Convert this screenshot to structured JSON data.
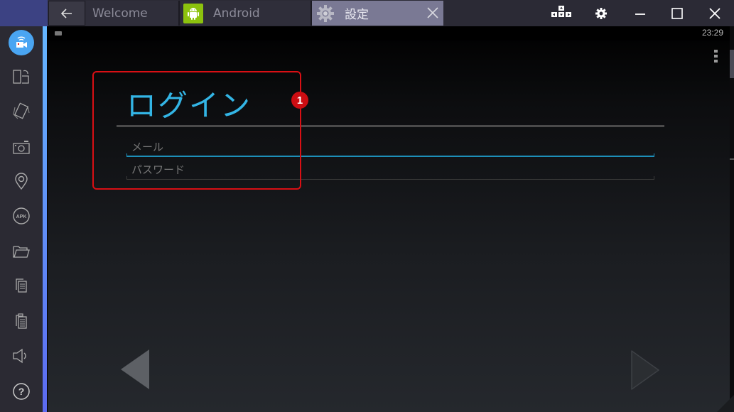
{
  "titlebar": {
    "tabs": [
      {
        "label": "Welcome",
        "active": false
      },
      {
        "label": "Android",
        "active": false
      },
      {
        "label": "設定",
        "active": true
      }
    ],
    "controls": [
      "keyboard-mapping-icon",
      "settings-icon",
      "minimize-icon",
      "maximize-icon",
      "close-icon"
    ]
  },
  "sidebar": {
    "items": [
      {
        "icon": "video-broadcast-icon",
        "active": true
      },
      {
        "icon": "rotate-screen-icon"
      },
      {
        "icon": "shake-icon"
      },
      {
        "icon": "camera-icon"
      },
      {
        "icon": "location-icon"
      },
      {
        "icon": "apk-install-icon",
        "label": "APK"
      },
      {
        "icon": "folder-icon"
      },
      {
        "icon": "copy-icon"
      },
      {
        "icon": "paste-icon"
      },
      {
        "icon": "volume-icon"
      },
      {
        "icon": "help-icon",
        "label": "?"
      }
    ]
  },
  "android": {
    "status_time": "23:29",
    "login": {
      "title": "ログイン",
      "email_placeholder": "メール",
      "email_value": "",
      "password_placeholder": "パスワード",
      "password_value": ""
    },
    "annotation_badge": "1"
  },
  "colors": {
    "accent": "#33b5e5",
    "highlight": "#d90f14",
    "active_tab": "#7a7994",
    "sidebar_active": "#4aa5f2"
  }
}
